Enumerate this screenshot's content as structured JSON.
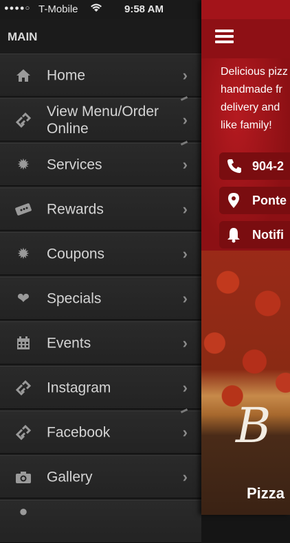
{
  "status_bar": {
    "signal": "●●●●○",
    "carrier": "T-Mobile",
    "time": "9:58 AM"
  },
  "menu": {
    "header": "MAIN",
    "items": [
      {
        "label": "Home",
        "icon": "home-icon"
      },
      {
        "label": "View Menu/Order Online",
        "icon": "link-icon"
      },
      {
        "label": "Services",
        "icon": "starburst-icon"
      },
      {
        "label": "Rewards",
        "icon": "ticket-icon"
      },
      {
        "label": "Coupons",
        "icon": "starburst-icon"
      },
      {
        "label": "Specials",
        "icon": "heart-icon"
      },
      {
        "label": "Events",
        "icon": "calendar-icon"
      },
      {
        "label": "Instagram",
        "icon": "link-icon"
      },
      {
        "label": "Facebook",
        "icon": "link-icon"
      },
      {
        "label": "Gallery",
        "icon": "camera-icon"
      }
    ]
  },
  "main": {
    "description": "Delicious pizz\nhandmade fr\ndelivery and\nlike family!",
    "buttons": [
      {
        "label": "904-2",
        "icon": "phone-icon"
      },
      {
        "label": "Ponte",
        "icon": "location-pin-icon"
      },
      {
        "label": "Notifi",
        "icon": "bell-icon"
      }
    ],
    "logo_text": "B",
    "bottom_text": "Pizza"
  },
  "colors": {
    "accent_red": "#a3141a",
    "menu_dark": "#232323"
  }
}
